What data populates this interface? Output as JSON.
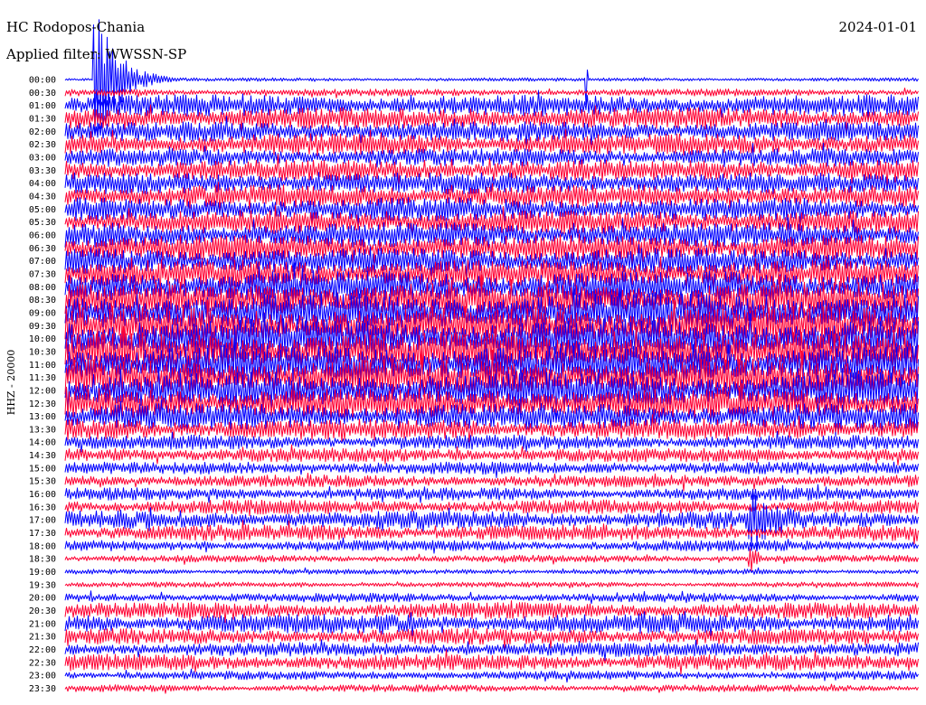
{
  "header": {
    "station": "HC Rodopos-Chania",
    "date": "2024-01-01",
    "filter": "Applied filter: WWSSN-SP"
  },
  "chart_data": {
    "type": "line",
    "title": "HC Rodopos-Chania",
    "ylabel": "HHZ - 20000",
    "trace_colors": [
      "#0000ff",
      "#ff0033"
    ],
    "rows": [
      {
        "label": "00:00",
        "noise_amp": 2,
        "color": "#0000ff"
      },
      {
        "label": "00:30",
        "noise_amp": 4,
        "color": "#ff0033"
      },
      {
        "label": "01:00",
        "noise_amp": 12,
        "color": "#0000ff"
      },
      {
        "label": "01:30",
        "noise_amp": 12,
        "color": "#ff0033"
      },
      {
        "label": "02:00",
        "noise_amp": 11,
        "color": "#0000ff"
      },
      {
        "label": "02:30",
        "noise_amp": 12,
        "color": "#ff0033"
      },
      {
        "label": "03:00",
        "noise_amp": 10,
        "color": "#0000ff"
      },
      {
        "label": "03:30",
        "noise_amp": 12,
        "color": "#ff0033"
      },
      {
        "label": "04:00",
        "noise_amp": 12,
        "color": "#0000ff"
      },
      {
        "label": "04:30",
        "noise_amp": 13,
        "color": "#ff0033"
      },
      {
        "label": "05:00",
        "noise_amp": 13,
        "color": "#0000ff"
      },
      {
        "label": "05:30",
        "noise_amp": 13,
        "color": "#ff0033"
      },
      {
        "label": "06:00",
        "noise_amp": 14,
        "color": "#0000ff"
      },
      {
        "label": "06:30",
        "noise_amp": 15,
        "color": "#ff0033"
      },
      {
        "label": "07:00",
        "noise_amp": 15,
        "color": "#0000ff"
      },
      {
        "label": "07:30",
        "noise_amp": 16,
        "color": "#ff0033"
      },
      {
        "label": "08:00",
        "noise_amp": 18,
        "color": "#0000ff"
      },
      {
        "label": "08:30",
        "noise_amp": 20,
        "color": "#ff0033"
      },
      {
        "label": "09:00",
        "noise_amp": 22,
        "color": "#0000ff"
      },
      {
        "label": "09:30",
        "noise_amp": 22,
        "color": "#ff0033"
      },
      {
        "label": "10:00",
        "noise_amp": 22,
        "color": "#0000ff"
      },
      {
        "label": "10:30",
        "noise_amp": 22,
        "color": "#ff0033"
      },
      {
        "label": "11:00",
        "noise_amp": 22,
        "color": "#0000ff"
      },
      {
        "label": "11:30",
        "noise_amp": 21,
        "color": "#ff0033"
      },
      {
        "label": "12:00",
        "noise_amp": 20,
        "color": "#0000ff"
      },
      {
        "label": "12:30",
        "noise_amp": 18,
        "color": "#ff0033"
      },
      {
        "label": "13:00",
        "noise_amp": 15,
        "color": "#0000ff"
      },
      {
        "label": "13:30",
        "noise_amp": 12,
        "color": "#ff0033"
      },
      {
        "label": "14:00",
        "noise_amp": 8,
        "color": "#0000ff"
      },
      {
        "label": "14:30",
        "noise_amp": 8,
        "color": "#ff0033"
      },
      {
        "label": "15:00",
        "noise_amp": 7,
        "color": "#0000ff"
      },
      {
        "label": "15:30",
        "noise_amp": 7,
        "color": "#ff0033"
      },
      {
        "label": "16:00",
        "noise_amp": 7,
        "color": "#0000ff"
      },
      {
        "label": "16:30",
        "noise_amp": 8,
        "color": "#ff0033"
      },
      {
        "label": "17:00",
        "noise_amp": 10,
        "color": "#0000ff"
      },
      {
        "label": "17:30",
        "noise_amp": 9,
        "color": "#ff0033"
      },
      {
        "label": "18:00",
        "noise_amp": 6,
        "color": "#0000ff"
      },
      {
        "label": "18:30",
        "noise_amp": 4,
        "color": "#ff0033"
      },
      {
        "label": "19:00",
        "noise_amp": 3,
        "color": "#0000ff"
      },
      {
        "label": "19:30",
        "noise_amp": 3,
        "color": "#ff0033"
      },
      {
        "label": "20:00",
        "noise_amp": 5,
        "color": "#0000ff"
      },
      {
        "label": "20:30",
        "noise_amp": 9,
        "color": "#ff0033"
      },
      {
        "label": "21:00",
        "noise_amp": 11,
        "color": "#0000ff"
      },
      {
        "label": "21:30",
        "noise_amp": 9,
        "color": "#ff0033"
      },
      {
        "label": "22:00",
        "noise_amp": 8,
        "color": "#0000ff"
      },
      {
        "label": "22:30",
        "noise_amp": 9,
        "color": "#ff0033"
      },
      {
        "label": "23:00",
        "noise_amp": 5,
        "color": "#0000ff"
      },
      {
        "label": "23:30",
        "noise_amp": 4,
        "color": "#ff0033"
      }
    ],
    "events": [
      {
        "row": "00:00",
        "minute_offset": 1.0,
        "amplitude": 90,
        "decay_minutes": 0.8
      },
      {
        "row": "00:00",
        "minute_offset": 18.3,
        "amplitude": 90,
        "decay_minutes": 0.03
      },
      {
        "row": "17:00",
        "minute_offset": 24.0,
        "amplitude": 45,
        "decay_minutes": 1.2
      },
      {
        "row": "18:30",
        "minute_offset": 24.0,
        "amplitude": 25,
        "decay_minutes": 0.3
      }
    ]
  }
}
